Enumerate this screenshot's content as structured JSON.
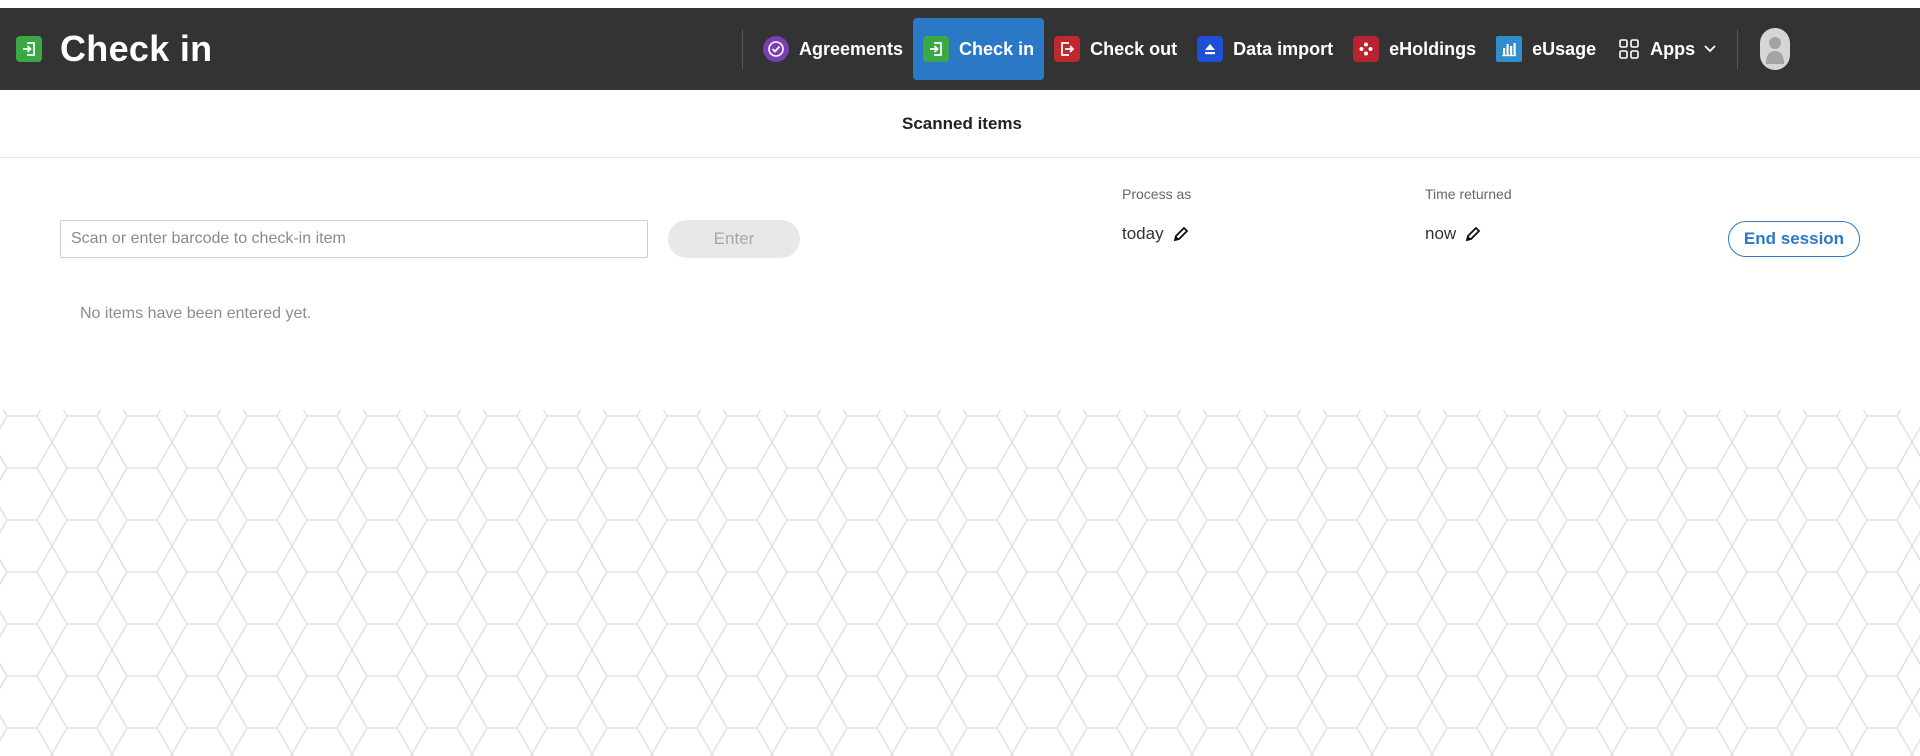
{
  "app": {
    "title": "Check in",
    "icon": "check-in-icon",
    "icon_color": "#3aa845"
  },
  "nav": {
    "items": [
      {
        "label": "Agreements",
        "icon": "agreements-icon",
        "color": "#8a2be2",
        "active": false
      },
      {
        "label": "Check in",
        "icon": "check-in-icon",
        "color": "#3aa845",
        "active": true
      },
      {
        "label": "Check out",
        "icon": "check-out-icon",
        "color": "#c0282d",
        "active": false
      },
      {
        "label": "Data import",
        "icon": "data-import-icon",
        "color": "#1f4fd6",
        "active": false
      },
      {
        "label": "eHoldings",
        "icon": "eholdings-icon",
        "color": "#b8232f",
        "active": false
      },
      {
        "label": "eUsage",
        "icon": "eusage-icon",
        "color": "#2f8ecb",
        "active": false
      },
      {
        "label": "Apps",
        "icon": "apps-grid-icon",
        "active": false
      }
    ],
    "active_color": "#2b78c7",
    "bar_color": "#333333"
  },
  "pane": {
    "title": "Scanned items"
  },
  "scan": {
    "placeholder": "Scan or enter barcode to check-in item",
    "enter_label": "Enter"
  },
  "process_as": {
    "label": "Process as",
    "value": "today"
  },
  "time_returned": {
    "label": "Time returned",
    "value": "now"
  },
  "end_session_label": "End session",
  "empty_message": "No items have been entered yet."
}
